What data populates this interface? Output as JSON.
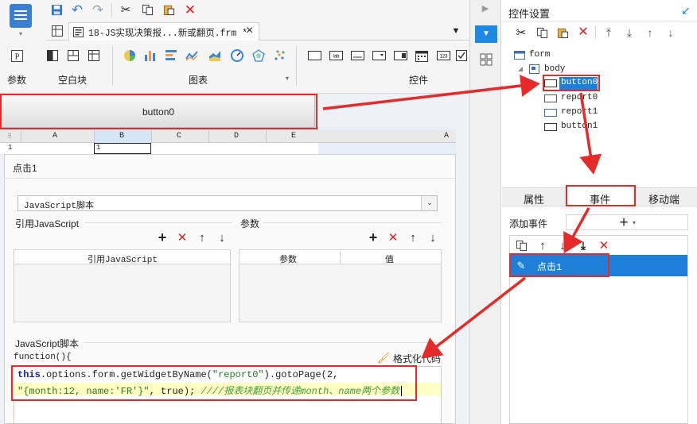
{
  "toolbar": {
    "tab_title": "18-JS实现决策报...新或翻页.frm *",
    "tab_close": "×",
    "groups": [
      "参数",
      "空白块",
      "图表",
      "控件"
    ]
  },
  "canvas": {
    "button_label": "button0",
    "columns": [
      "A",
      "B",
      "C",
      "D",
      "E"
    ],
    "right_col": "A",
    "row1": "1",
    "cell_b1": "1"
  },
  "dialog": {
    "title": "点击1",
    "type_select": "JavaScript脚本",
    "ref_js_label": "引用JavaScript",
    "params_label": "参数",
    "ref_js_header": "引用JavaScript",
    "param_header": "参数",
    "value_header": "值",
    "script_label": "JavaScript脚本",
    "function_header": "function(){",
    "format_button": "格式化代码",
    "code_line1_kw": "this",
    "code_line1_rest": ".options.form.getWidgetByName(",
    "code_line1_str": "\"report0\"",
    "code_line1_end": ").gotoPage(2,",
    "code_line2_str": "\"{month:12, name:'FR'}\"",
    "code_line2_mid": ", true);",
    "code_line2_comment": "////报表块翻页并传递month、name两个参数"
  },
  "panel": {
    "title": "控件设置",
    "tree": [
      "form",
      "body",
      "button0",
      "report0",
      "report1",
      "button1"
    ],
    "tabs": [
      "属性",
      "事件",
      "移动端"
    ],
    "add_event_label": "添加事件",
    "event_item": "点击1"
  }
}
